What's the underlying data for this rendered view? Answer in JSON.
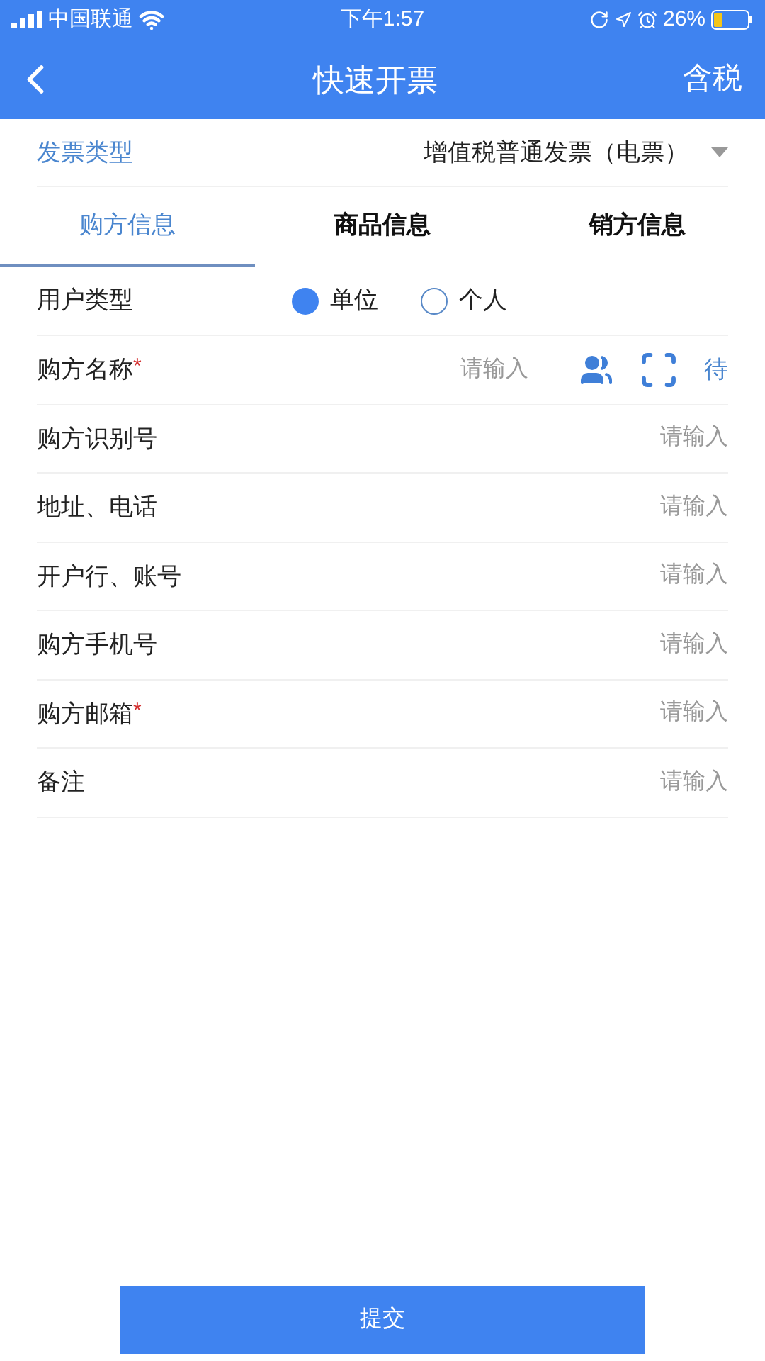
{
  "status_bar": {
    "carrier": "中国联通",
    "time": "下午1:57",
    "battery": "26%"
  },
  "nav": {
    "title": "快速开票",
    "action": "含税"
  },
  "invoice_type": {
    "label": "发票类型",
    "value": "增值税普通发票（电票）"
  },
  "tabs": [
    {
      "label": "购方信息",
      "selected": true
    },
    {
      "label": "商品信息",
      "selected": false
    },
    {
      "label": "销方信息",
      "selected": false
    }
  ],
  "user_type": {
    "label": "用户类型",
    "options": [
      {
        "label": "单位",
        "selected": true
      },
      {
        "label": "个人",
        "selected": false
      }
    ]
  },
  "fields": [
    {
      "label": "购方名称",
      "required_mark": "*",
      "placeholder": "请输入",
      "kind": "lookup",
      "extra": "待"
    },
    {
      "label": "购方识别号",
      "placeholder": "请输入",
      "kind": "plain"
    },
    {
      "label": "地址、电话",
      "placeholder": "请输入",
      "kind": "plain"
    },
    {
      "label": "开户行、账号",
      "placeholder": "请输入",
      "kind": "plain"
    },
    {
      "label": "购方手机号",
      "placeholder": "请输入",
      "kind": "plain"
    },
    {
      "label": "购方邮箱",
      "required_mark": "*",
      "placeholder": "请输入",
      "kind": "plain"
    },
    {
      "label": "备注",
      "placeholder": "请输入",
      "kind": "plain"
    }
  ],
  "submit": "提交"
}
